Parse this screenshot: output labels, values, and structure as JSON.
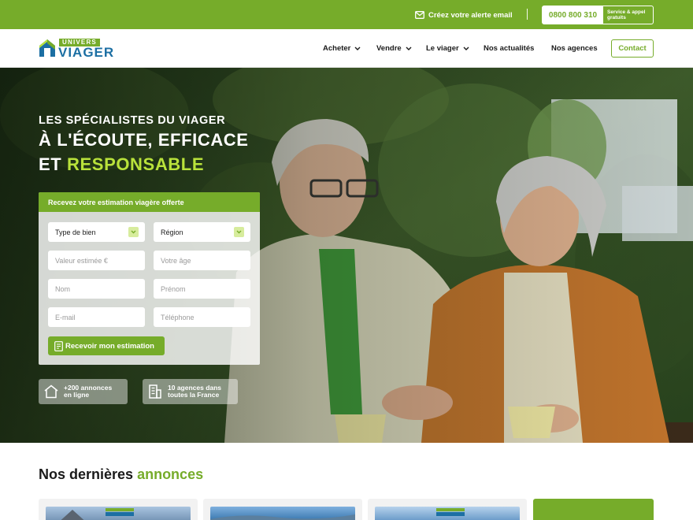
{
  "topbar": {
    "alert_label": "Créez votre alerte email",
    "phone": "0800 800 310",
    "phone_note": "Service & appel gratuits"
  },
  "brand": {
    "logo_top": "UNIVERS",
    "logo_bottom": "VIAGER"
  },
  "nav": {
    "items": [
      {
        "label": "Acheter",
        "has_dropdown": true
      },
      {
        "label": "Vendre",
        "has_dropdown": true
      },
      {
        "label": "Le viager",
        "has_dropdown": true
      },
      {
        "label": "Nos actualités",
        "has_dropdown": false
      },
      {
        "label": "Nos agences",
        "has_dropdown": false
      }
    ],
    "contact": "Contact"
  },
  "hero": {
    "subtitle": "LES SPÉCIALISTES DU VIAGER",
    "title_line1": "À L'ÉCOUTE, EFFICACE",
    "title_line2_start": "ET ",
    "title_line2_accent": "RESPONSABLE"
  },
  "form": {
    "heading": "Recevez votre estimation viagère offerte",
    "type_bien": "Type de bien",
    "region": "Région",
    "valeur_placeholder": "Valeur estimée €",
    "age_placeholder": "Votre âge",
    "nom_placeholder": "Nom",
    "prenom_placeholder": "Prénom",
    "email_placeholder": "E-mail",
    "tel_placeholder": "Téléphone",
    "submit": "Recevoir mon estimation"
  },
  "badges": [
    {
      "line1": "+200 annonces",
      "line2": "en ligne",
      "icon": "house-icon"
    },
    {
      "line1": "10 agences dans",
      "line2": "toutes la France",
      "icon": "building-icon"
    }
  ],
  "section": {
    "title_start": "Nos dernières ",
    "title_accent": "annonces"
  },
  "colors": {
    "brand_green": "#76ac2a",
    "accent_lime": "#b9e23b",
    "brand_blue": "#1c6fa3"
  }
}
